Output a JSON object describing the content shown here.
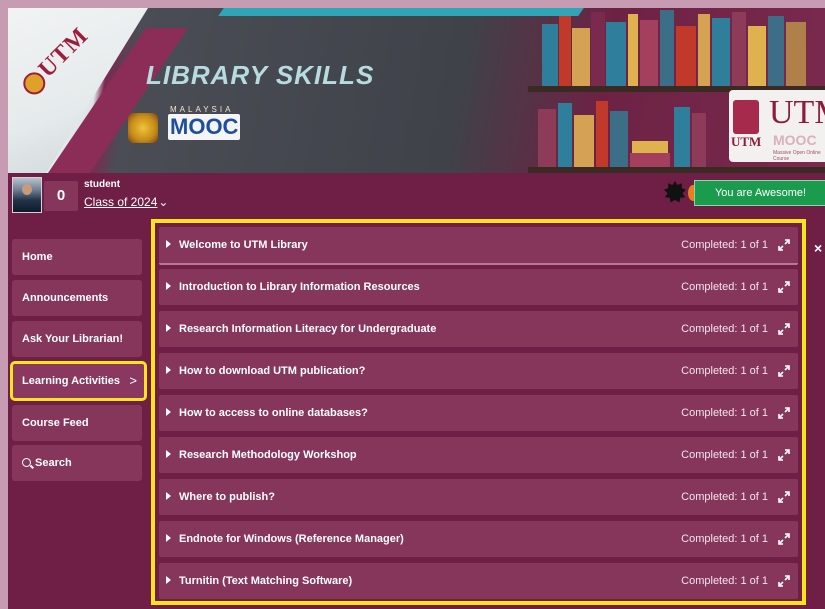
{
  "banner": {
    "left_logo": "UTM",
    "title": "LIBRARY SKILLS",
    "mooc_top": "MALAYSIA",
    "mooc_logo": "MOOC",
    "right_logo_big": "UTM",
    "right_logo_small": "UTM",
    "right_logo_mooc": "MOOC",
    "right_logo_tag": "Massive Open Online Course"
  },
  "user": {
    "points": "0",
    "name": "student",
    "class_label": "Class of 2024",
    "class_chevron": "chevron-down-icon",
    "badge_text": "You are Awesome!",
    "badge_color": "#1b9b4d"
  },
  "sidebar": {
    "items": [
      {
        "label": "Home"
      },
      {
        "label": "Announcements"
      },
      {
        "label": "Ask Your Librarian!"
      },
      {
        "label": "Learning Activities",
        "active": true,
        "icon": "chevron-right-icon"
      },
      {
        "label": "Course Feed"
      },
      {
        "label": "Search",
        "icon": "search-icon"
      }
    ]
  },
  "activities": {
    "close_label": "×",
    "highlight_color": "#f7e51b",
    "items": [
      {
        "title": "Welcome to UTM Library",
        "status": "Completed: 1 of 1"
      },
      {
        "title": "Introduction to Library Information Resources",
        "status": "Completed: 1 of 1"
      },
      {
        "title": "Research Information Literacy for Undergraduate",
        "status": "Completed: 1 of 1"
      },
      {
        "title": "How to download UTM publication?",
        "status": "Completed: 1 of 1"
      },
      {
        "title": "How to access to online databases?",
        "status": "Completed: 1 of 1"
      },
      {
        "title": "Research Methodology Workshop",
        "status": "Completed: 1 of 1"
      },
      {
        "title": "Where to publish?",
        "status": "Completed: 1 of 1"
      },
      {
        "title": "Endnote for Windows (Reference Manager)",
        "status": "Completed: 1 of 1"
      },
      {
        "title": "Turnitin (Text Matching Software)",
        "status": "Completed: 1 of 1"
      }
    ]
  }
}
